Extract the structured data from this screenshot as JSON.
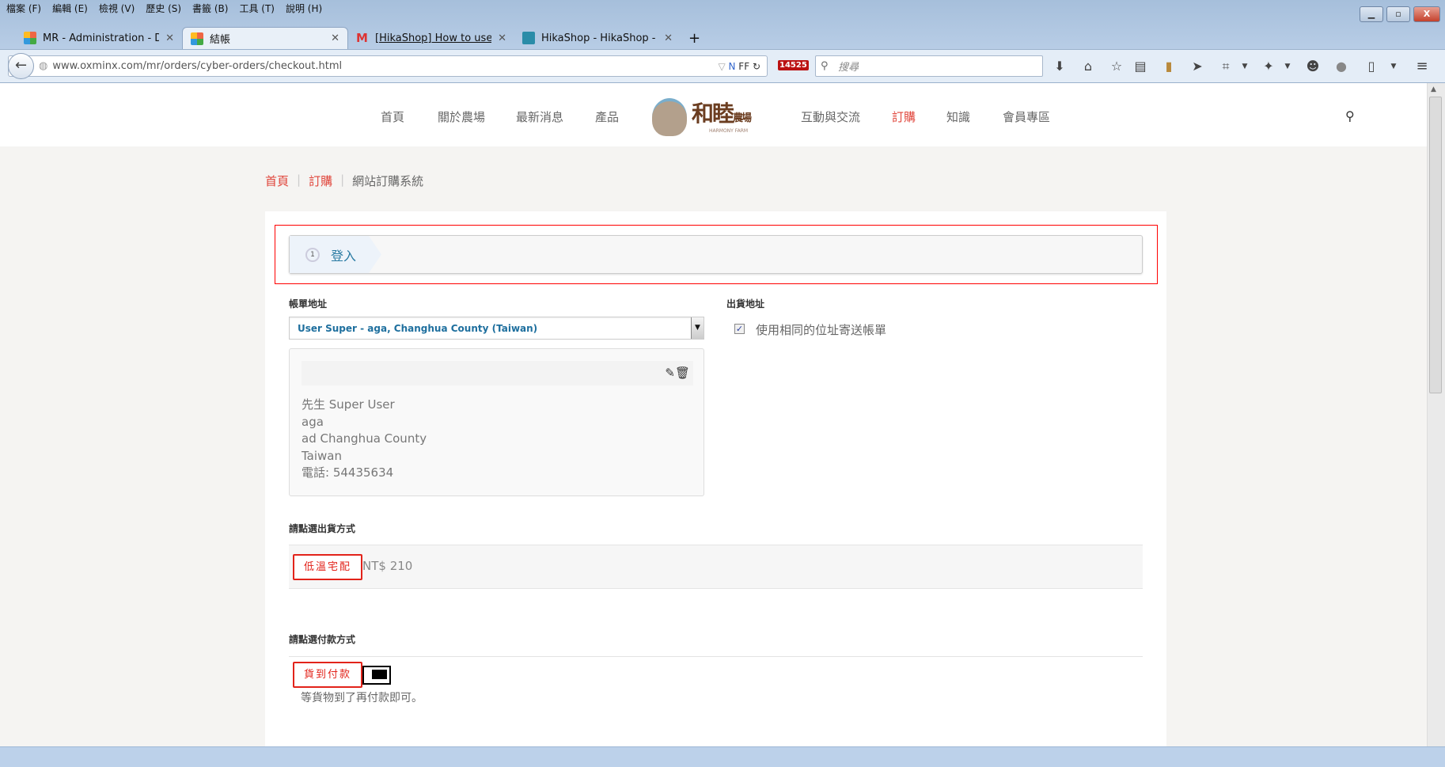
{
  "browser": {
    "menu": [
      "檔案 (F)",
      "編輯 (E)",
      "檢視 (V)",
      "歷史 (S)",
      "書籤 (B)",
      "工具 (T)",
      "說明 (H)"
    ],
    "tabs": [
      {
        "label": "MR - Administration - Di...",
        "active": false
      },
      {
        "label": "結帳",
        "active": true
      },
      {
        "label": "[HikaShop] How to use a ...",
        "active": false
      },
      {
        "label": "HikaShop - HikaShop - T...",
        "active": false
      }
    ],
    "url": "www.oxminx.com/mr/orders/cyber-orders/checkout.html",
    "reader_label": "FF",
    "badge_count": "14525",
    "search_placeholder": "搜尋"
  },
  "site": {
    "nav_left": [
      "首頁",
      "關於農場",
      "最新消息",
      "產品"
    ],
    "nav_right": [
      "互動與交流",
      "訂購",
      "知識",
      "會員專區"
    ],
    "active_nav": "訂購",
    "logo_text": "和睦農場",
    "logo_sub": "HARMONY FARM",
    "accent": "#e0443a"
  },
  "breadcrumb": [
    "首頁",
    "訂購",
    "網站訂購系統"
  ],
  "checkout": {
    "step_number": "1",
    "step_label": "登入",
    "billing_title": "帳單地址",
    "billing_selected": "User Super - aga, Changhua County (Taiwan)",
    "address_lines": [
      "先生 Super User",
      "aga",
      "ad Changhua County",
      "Taiwan",
      "電話: 54435634"
    ],
    "shipping_title": "出貨地址",
    "same_address_label": "使用相同的位址寄送帳單",
    "same_address_checked": true,
    "shipping_method_title": "請點選出貨方式",
    "shipping_method": "低溫宅配",
    "shipping_price": "NT$ 210",
    "payment_method_title": "請點選付款方式",
    "payment_method": "貨到付款",
    "payment_desc": "等貨物到了再付款即可。"
  }
}
